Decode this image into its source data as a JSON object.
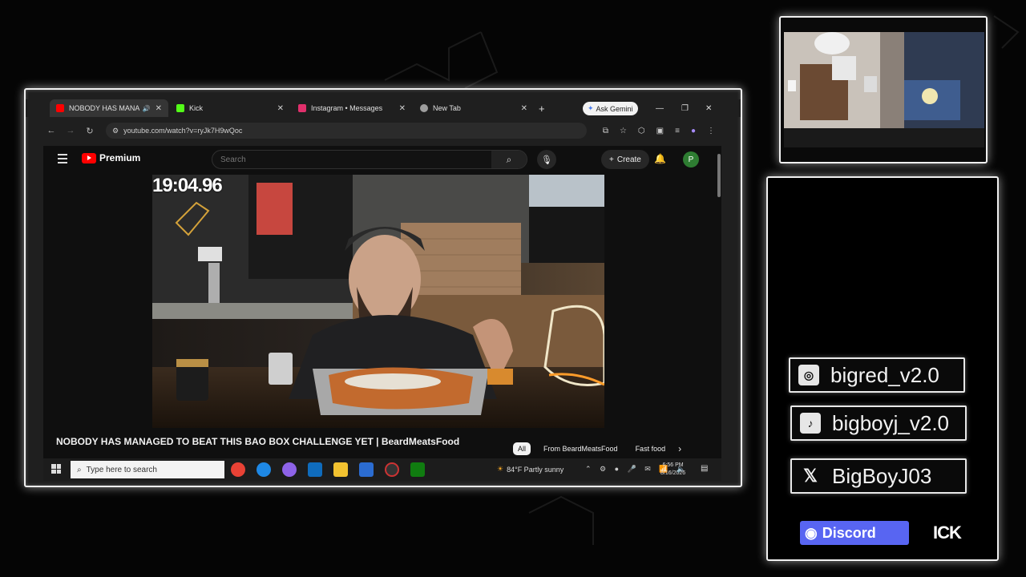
{
  "browser": {
    "tabs": [
      {
        "label": "NOBODY HAS MANAGED",
        "active": true,
        "favicon_color": "#ff0000"
      },
      {
        "label": "Kick",
        "active": false,
        "favicon_color": "#53fc18"
      },
      {
        "label": "Instagram • Messages",
        "active": false,
        "favicon_color": "#e1306c"
      },
      {
        "label": "New Tab",
        "active": false,
        "favicon_color": "#9e9e9e"
      }
    ],
    "ask_gemini": "Ask Gemini",
    "url": "youtube.com/watch?v=ryJk7H9wQoc"
  },
  "youtube": {
    "brand": "Premium",
    "search_placeholder": "Search",
    "create_label": "Create",
    "avatar_letter": "P",
    "video_title": "NOBODY HAS MANAGED TO BEAT THIS BAO BOX CHALLENGE YET | BeardMeatsFood",
    "chips": [
      {
        "label": "All",
        "selected": true
      },
      {
        "label": "From BeardMeatsFood",
        "selected": false
      },
      {
        "label": "Fast food",
        "selected": false
      }
    ]
  },
  "overlay": {
    "timer": "19:04.96"
  },
  "taskbar": {
    "search_placeholder": "Type here to search",
    "weather": "84°F  Partly sunny",
    "time": "6:56 PM",
    "date": "8/16/2026"
  },
  "socials": [
    {
      "platform_icon": "instagram-icon",
      "handle": "bigred_v2.0"
    },
    {
      "platform_icon": "tiktok-icon",
      "handle": "bigboyj_v2.0"
    },
    {
      "platform_icon": "x-icon",
      "handle": "BigBoyJ03"
    }
  ],
  "discord_label": "Discord",
  "kick_label": "ICK",
  "colors": {
    "youtube_red": "#ff0000",
    "discord_blurple": "#5865f2",
    "frame_glow": "#f0f0f0"
  }
}
